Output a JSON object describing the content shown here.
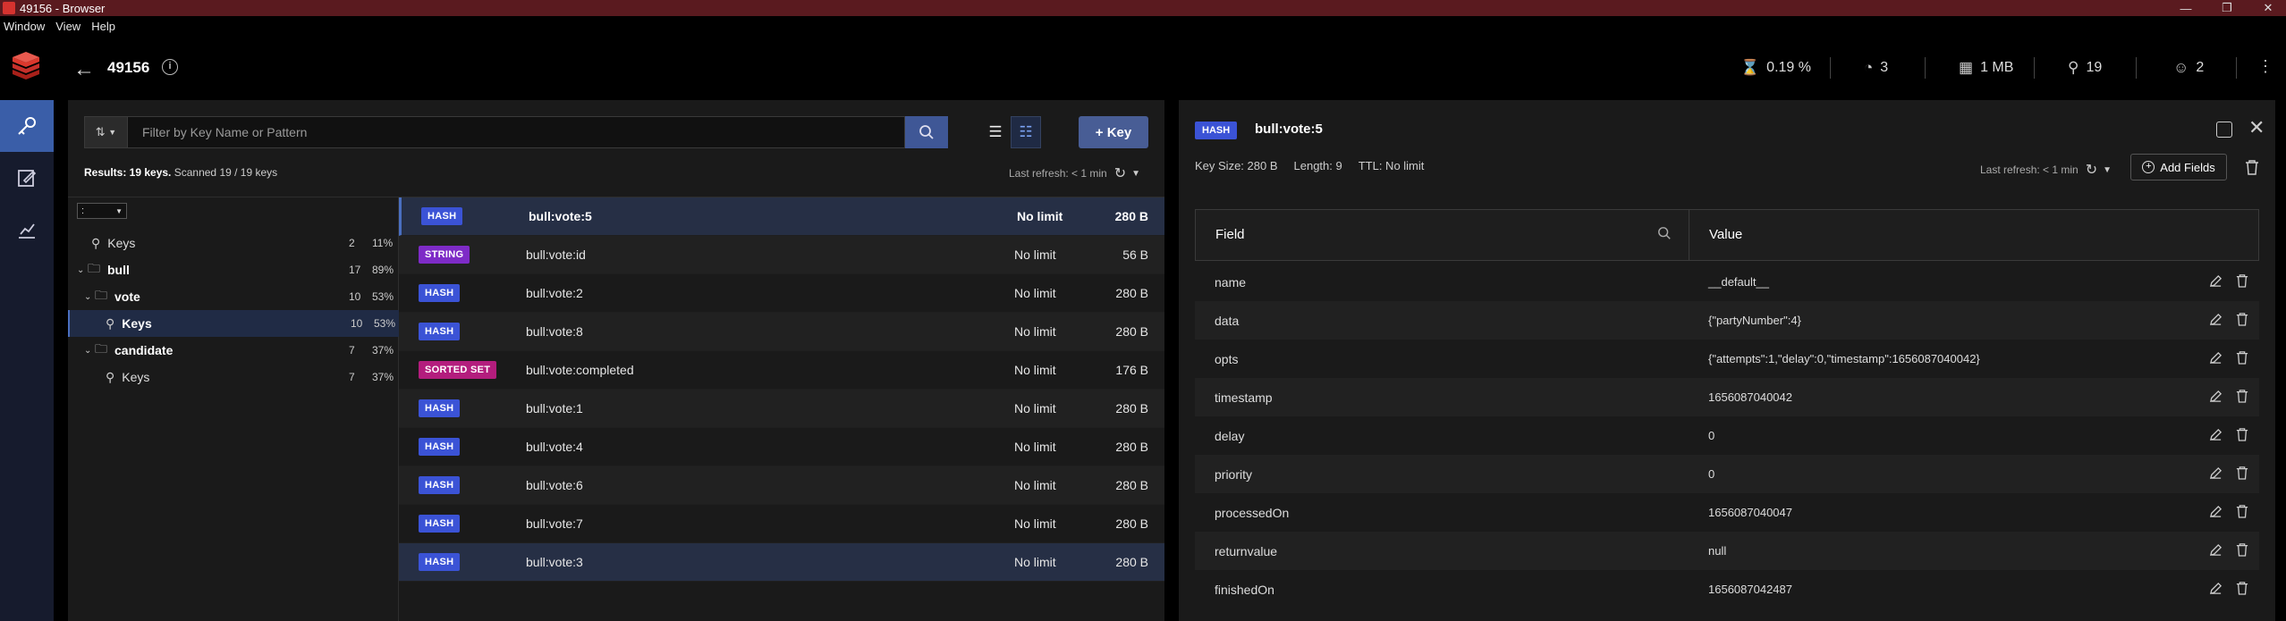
{
  "window": {
    "title": "49156 - Browser",
    "menu": [
      "Window",
      "View",
      "Help"
    ]
  },
  "header": {
    "db_name": "49156",
    "stats": {
      "cpu": "0.19 %",
      "ops": "3",
      "memory": "1 MB",
      "keys": "19",
      "clients": "2"
    }
  },
  "filter": {
    "placeholder": "Filter by Key Name or Pattern",
    "add_key_label": "+ Key"
  },
  "results": {
    "prefix": "Results: 19 keys.",
    "scanned": "Scanned 19 / 19 keys"
  },
  "last_refresh": "Last refresh: < 1 min",
  "tree": {
    "delimiter": ":",
    "rows": [
      {
        "label": "Keys",
        "count": "2",
        "pct": "11%"
      },
      {
        "label": "bull",
        "count": "17",
        "pct": "89%"
      },
      {
        "label": "vote",
        "count": "10",
        "pct": "53%"
      },
      {
        "label": "Keys",
        "count": "10",
        "pct": "53%"
      },
      {
        "label": "candidate",
        "count": "7",
        "pct": "37%"
      },
      {
        "label": "Keys",
        "count": "7",
        "pct": "37%"
      }
    ]
  },
  "keys": [
    {
      "type": "HASH",
      "name": "bull:vote:5",
      "ttl": "No limit",
      "size": "280 B"
    },
    {
      "type": "STRING",
      "name": "bull:vote:id",
      "ttl": "No limit",
      "size": "56 B"
    },
    {
      "type": "HASH",
      "name": "bull:vote:2",
      "ttl": "No limit",
      "size": "280 B"
    },
    {
      "type": "HASH",
      "name": "bull:vote:8",
      "ttl": "No limit",
      "size": "280 B"
    },
    {
      "type": "SORTED SET",
      "name": "bull:vote:completed",
      "ttl": "No limit",
      "size": "176 B"
    },
    {
      "type": "HASH",
      "name": "bull:vote:1",
      "ttl": "No limit",
      "size": "280 B"
    },
    {
      "type": "HASH",
      "name": "bull:vote:4",
      "ttl": "No limit",
      "size": "280 B"
    },
    {
      "type": "HASH",
      "name": "bull:vote:6",
      "ttl": "No limit",
      "size": "280 B"
    },
    {
      "type": "HASH",
      "name": "bull:vote:7",
      "ttl": "No limit",
      "size": "280 B"
    },
    {
      "type": "HASH",
      "name": "bull:vote:3",
      "ttl": "No limit",
      "size": "280 B"
    }
  ],
  "type_colors": {
    "HASH": "#3b53d6",
    "STRING": "#7e2bc7",
    "SORTED SET": "#b31d7d"
  },
  "details": {
    "type": "HASH",
    "key": "bull:vote:5",
    "key_size": "Key Size: 280 B",
    "length": "Length: 9",
    "ttl": "TTL:  No limit",
    "last_refresh": "Last refresh: < 1 min",
    "add_fields_label": "Add Fields",
    "columns": {
      "field": "Field",
      "value": "Value"
    },
    "fields": [
      {
        "field": "name",
        "value": "__default__"
      },
      {
        "field": "data",
        "value": "{\"partyNumber\":4}"
      },
      {
        "field": "opts",
        "value": "{\"attempts\":1,\"delay\":0,\"timestamp\":1656087040042}"
      },
      {
        "field": "timestamp",
        "value": "1656087040042"
      },
      {
        "field": "delay",
        "value": "0"
      },
      {
        "field": "priority",
        "value": "0"
      },
      {
        "field": "processedOn",
        "value": "1656087040047"
      },
      {
        "field": "returnvalue",
        "value": "null"
      },
      {
        "field": "finishedOn",
        "value": "1656087042487"
      }
    ]
  }
}
